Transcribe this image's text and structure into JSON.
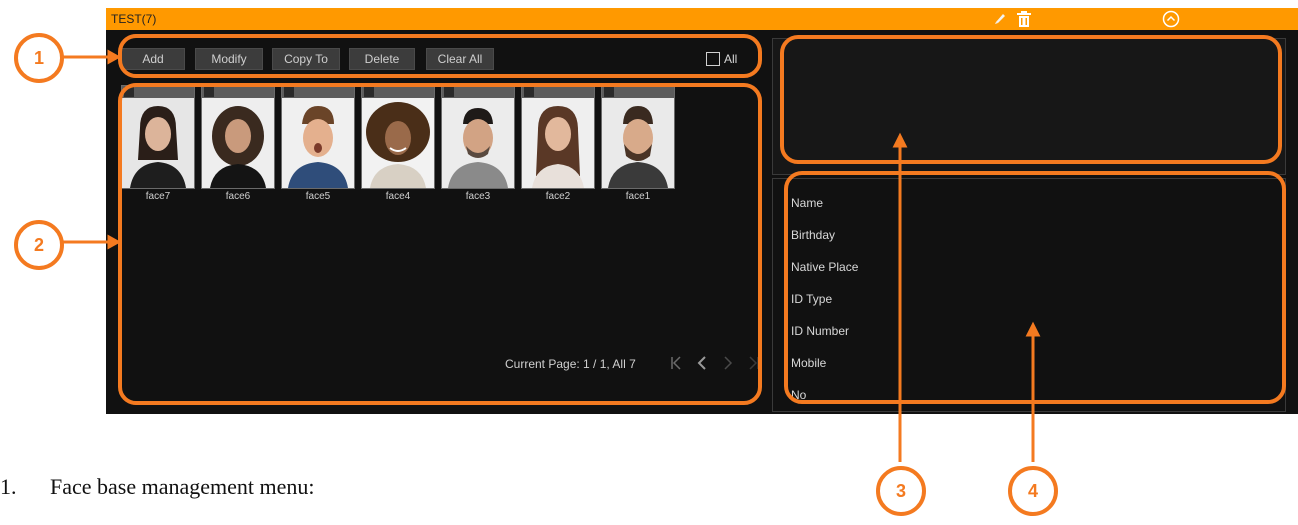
{
  "window": {
    "title": "TEST(7)",
    "colors": {
      "titlebar": "#ff9900",
      "background": "#111111",
      "annotation": "#f47a20"
    },
    "icons": [
      "edit-icon",
      "trash-icon",
      "collapse-icon"
    ]
  },
  "toolbar": {
    "add": "Add",
    "modify": "Modify",
    "copy_to": "Copy To",
    "delete": "Delete",
    "clear_all": "Clear All",
    "all": "All"
  },
  "faces": [
    {
      "name": "face7"
    },
    {
      "name": "face6"
    },
    {
      "name": "face5"
    },
    {
      "name": "face4"
    },
    {
      "name": "face3"
    },
    {
      "name": "face2"
    },
    {
      "name": "face1"
    }
  ],
  "pager": {
    "text": "Current Page: 1 / 1, All 7"
  },
  "info_fields": [
    "Name",
    "Birthday",
    "Native Place",
    "ID Type",
    "ID Number",
    "Mobile",
    "No"
  ],
  "annotations": [
    "1",
    "2",
    "3",
    "4"
  ],
  "caption": {
    "number": "1.",
    "text": "Face base management menu:"
  }
}
